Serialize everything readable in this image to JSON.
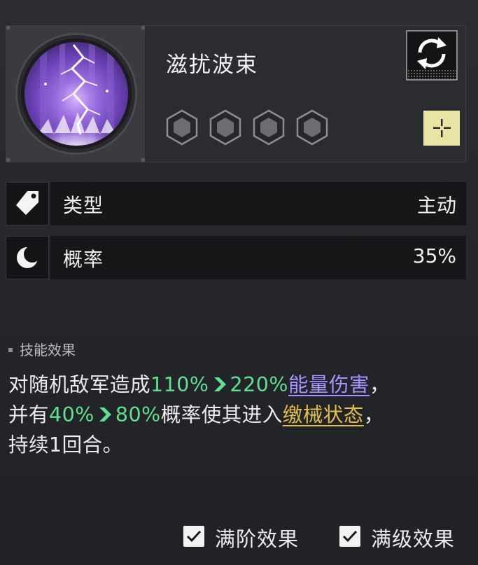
{
  "skill": {
    "name": "滋扰波束",
    "icon": "lightning-icon",
    "level_hexes": [
      "hex-slot-icon",
      "hex-slot-icon",
      "hex-slot-icon",
      "hex-slot-icon"
    ]
  },
  "stats": [
    {
      "icon": "tag-icon",
      "label": "类型",
      "value": "主动"
    },
    {
      "icon": "moon-icon",
      "label": "概率",
      "value": "35%"
    }
  ],
  "effect": {
    "title": "技能效果",
    "line1_prefix": "对随机敌军造成",
    "line1_from": "110%",
    "line1_to": "220%",
    "line1_link": "能量伤害",
    "line1_suffix": "，",
    "line2_prefix": "并有",
    "line2_from": "40%",
    "line2_to": "80%",
    "line2_mid": "概率使其进入",
    "line2_link": "缴械状态",
    "line2_suffix": "，",
    "line3": "持续1回合。"
  },
  "toggles": {
    "max_rank": "满阶效果",
    "max_level": "满级效果"
  },
  "colors": {
    "highlight_green": "#5ee08e",
    "link_purple": "#a694ff",
    "link_yellow": "#e2bf4a",
    "plus_button": "#e9e3a6"
  }
}
